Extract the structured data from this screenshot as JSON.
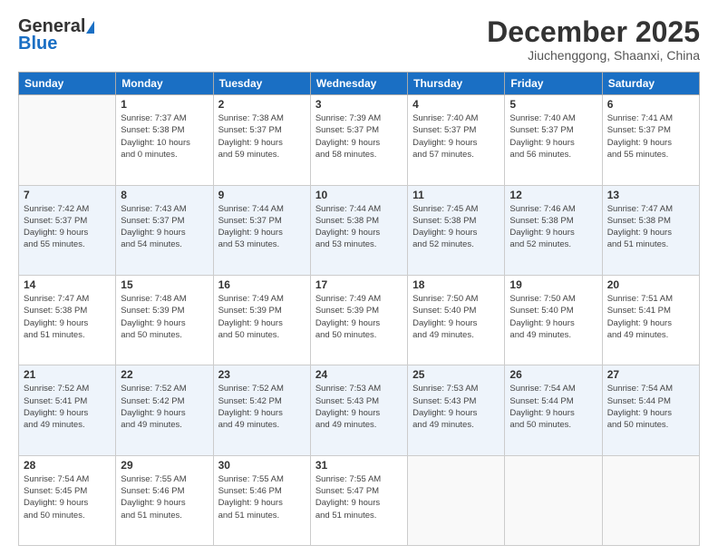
{
  "header": {
    "logo_general": "General",
    "logo_blue": "Blue",
    "month_title": "December 2025",
    "location": "Jiuchenggong, Shaanxi, China"
  },
  "weekdays": [
    "Sunday",
    "Monday",
    "Tuesday",
    "Wednesday",
    "Thursday",
    "Friday",
    "Saturday"
  ],
  "weeks": [
    [
      {
        "day": "",
        "sunrise": "",
        "sunset": "",
        "daylight": ""
      },
      {
        "day": "1",
        "sunrise": "Sunrise: 7:37 AM",
        "sunset": "Sunset: 5:38 PM",
        "daylight": "Daylight: 10 hours and 0 minutes."
      },
      {
        "day": "2",
        "sunrise": "Sunrise: 7:38 AM",
        "sunset": "Sunset: 5:37 PM",
        "daylight": "Daylight: 9 hours and 59 minutes."
      },
      {
        "day": "3",
        "sunrise": "Sunrise: 7:39 AM",
        "sunset": "Sunset: 5:37 PM",
        "daylight": "Daylight: 9 hours and 58 minutes."
      },
      {
        "day": "4",
        "sunrise": "Sunrise: 7:40 AM",
        "sunset": "Sunset: 5:37 PM",
        "daylight": "Daylight: 9 hours and 57 minutes."
      },
      {
        "day": "5",
        "sunrise": "Sunrise: 7:40 AM",
        "sunset": "Sunset: 5:37 PM",
        "daylight": "Daylight: 9 hours and 56 minutes."
      },
      {
        "day": "6",
        "sunrise": "Sunrise: 7:41 AM",
        "sunset": "Sunset: 5:37 PM",
        "daylight": "Daylight: 9 hours and 55 minutes."
      }
    ],
    [
      {
        "day": "7",
        "sunrise": "Sunrise: 7:42 AM",
        "sunset": "Sunset: 5:37 PM",
        "daylight": "Daylight: 9 hours and 55 minutes."
      },
      {
        "day": "8",
        "sunrise": "Sunrise: 7:43 AM",
        "sunset": "Sunset: 5:37 PM",
        "daylight": "Daylight: 9 hours and 54 minutes."
      },
      {
        "day": "9",
        "sunrise": "Sunrise: 7:44 AM",
        "sunset": "Sunset: 5:37 PM",
        "daylight": "Daylight: 9 hours and 53 minutes."
      },
      {
        "day": "10",
        "sunrise": "Sunrise: 7:44 AM",
        "sunset": "Sunset: 5:38 PM",
        "daylight": "Daylight: 9 hours and 53 minutes."
      },
      {
        "day": "11",
        "sunrise": "Sunrise: 7:45 AM",
        "sunset": "Sunset: 5:38 PM",
        "daylight": "Daylight: 9 hours and 52 minutes."
      },
      {
        "day": "12",
        "sunrise": "Sunrise: 7:46 AM",
        "sunset": "Sunset: 5:38 PM",
        "daylight": "Daylight: 9 hours and 52 minutes."
      },
      {
        "day": "13",
        "sunrise": "Sunrise: 7:47 AM",
        "sunset": "Sunset: 5:38 PM",
        "daylight": "Daylight: 9 hours and 51 minutes."
      }
    ],
    [
      {
        "day": "14",
        "sunrise": "Sunrise: 7:47 AM",
        "sunset": "Sunset: 5:38 PM",
        "daylight": "Daylight: 9 hours and 51 minutes."
      },
      {
        "day": "15",
        "sunrise": "Sunrise: 7:48 AM",
        "sunset": "Sunset: 5:39 PM",
        "daylight": "Daylight: 9 hours and 50 minutes."
      },
      {
        "day": "16",
        "sunrise": "Sunrise: 7:49 AM",
        "sunset": "Sunset: 5:39 PM",
        "daylight": "Daylight: 9 hours and 50 minutes."
      },
      {
        "day": "17",
        "sunrise": "Sunrise: 7:49 AM",
        "sunset": "Sunset: 5:39 PM",
        "daylight": "Daylight: 9 hours and 50 minutes."
      },
      {
        "day": "18",
        "sunrise": "Sunrise: 7:50 AM",
        "sunset": "Sunset: 5:40 PM",
        "daylight": "Daylight: 9 hours and 49 minutes."
      },
      {
        "day": "19",
        "sunrise": "Sunrise: 7:50 AM",
        "sunset": "Sunset: 5:40 PM",
        "daylight": "Daylight: 9 hours and 49 minutes."
      },
      {
        "day": "20",
        "sunrise": "Sunrise: 7:51 AM",
        "sunset": "Sunset: 5:41 PM",
        "daylight": "Daylight: 9 hours and 49 minutes."
      }
    ],
    [
      {
        "day": "21",
        "sunrise": "Sunrise: 7:52 AM",
        "sunset": "Sunset: 5:41 PM",
        "daylight": "Daylight: 9 hours and 49 minutes."
      },
      {
        "day": "22",
        "sunrise": "Sunrise: 7:52 AM",
        "sunset": "Sunset: 5:42 PM",
        "daylight": "Daylight: 9 hours and 49 minutes."
      },
      {
        "day": "23",
        "sunrise": "Sunrise: 7:52 AM",
        "sunset": "Sunset: 5:42 PM",
        "daylight": "Daylight: 9 hours and 49 minutes."
      },
      {
        "day": "24",
        "sunrise": "Sunrise: 7:53 AM",
        "sunset": "Sunset: 5:43 PM",
        "daylight": "Daylight: 9 hours and 49 minutes."
      },
      {
        "day": "25",
        "sunrise": "Sunrise: 7:53 AM",
        "sunset": "Sunset: 5:43 PM",
        "daylight": "Daylight: 9 hours and 49 minutes."
      },
      {
        "day": "26",
        "sunrise": "Sunrise: 7:54 AM",
        "sunset": "Sunset: 5:44 PM",
        "daylight": "Daylight: 9 hours and 50 minutes."
      },
      {
        "day": "27",
        "sunrise": "Sunrise: 7:54 AM",
        "sunset": "Sunset: 5:44 PM",
        "daylight": "Daylight: 9 hours and 50 minutes."
      }
    ],
    [
      {
        "day": "28",
        "sunrise": "Sunrise: 7:54 AM",
        "sunset": "Sunset: 5:45 PM",
        "daylight": "Daylight: 9 hours and 50 minutes."
      },
      {
        "day": "29",
        "sunrise": "Sunrise: 7:55 AM",
        "sunset": "Sunset: 5:46 PM",
        "daylight": "Daylight: 9 hours and 51 minutes."
      },
      {
        "day": "30",
        "sunrise": "Sunrise: 7:55 AM",
        "sunset": "Sunset: 5:46 PM",
        "daylight": "Daylight: 9 hours and 51 minutes."
      },
      {
        "day": "31",
        "sunrise": "Sunrise: 7:55 AM",
        "sunset": "Sunset: 5:47 PM",
        "daylight": "Daylight: 9 hours and 51 minutes."
      },
      {
        "day": "",
        "sunrise": "",
        "sunset": "",
        "daylight": ""
      },
      {
        "day": "",
        "sunrise": "",
        "sunset": "",
        "daylight": ""
      },
      {
        "day": "",
        "sunrise": "",
        "sunset": "",
        "daylight": ""
      }
    ]
  ]
}
